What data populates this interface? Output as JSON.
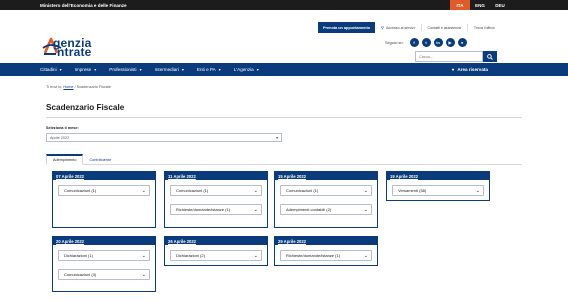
{
  "topbar": {
    "ministry": "Ministero dell'Economia e delle Finanze",
    "languages": [
      "ITA",
      "ENG",
      "DEU"
    ]
  },
  "utilbar": {
    "appointment": "Prenota un appuntamento",
    "links": [
      "Accesso ai servizi",
      "Contatti e assistenza",
      "Trova l'ufficio"
    ]
  },
  "logo": {
    "line1": "genzia",
    "line2": "ntrate"
  },
  "social": {
    "label": "Seguici su:",
    "icons": [
      "f",
      "t",
      "in",
      "▶",
      "●"
    ]
  },
  "search": {
    "placeholder": "Cerca..."
  },
  "nav": {
    "items": [
      "Cittadini",
      "Imprese",
      "Professionisti",
      "Intermediari",
      "Enti e PA",
      "L'Agenzia"
    ],
    "area": "Area riservata"
  },
  "breadcrumb": {
    "prefix": "Ti trovi in:",
    "home": "Home",
    "sep": "/",
    "current": "Scadenzario Fiscale"
  },
  "page": {
    "title": "Scadenzario Fiscale"
  },
  "filter": {
    "label": "Seleziona il mese:",
    "value": "Aprile 2022"
  },
  "tabs": [
    "Adempimento",
    "Contribuente"
  ],
  "cards": [
    {
      "date": "07 Aprile 2022",
      "rows": [
        "Comunicazioni (1)"
      ]
    },
    {
      "date": "11 Aprile 2022",
      "rows": [
        "Comunicazioni (1)",
        "Richieste/domande/istanze (1)"
      ]
    },
    {
      "date": "15 Aprile 2022",
      "rows": [
        "Comunicazioni (1)",
        "Adempimenti contabili (2)"
      ]
    },
    {
      "date": "19 Aprile 2022",
      "rows": [
        "Versamenti (58)"
      ]
    },
    {
      "date": "20 Aprile 2022",
      "rows": [
        "Dichiarazioni (1)",
        "Comunicazioni (3)"
      ]
    },
    {
      "date": "26 Aprile 2022",
      "rows": [
        "Dichiarazioni (2)"
      ]
    },
    {
      "date": "29 Aprile 2022",
      "rows": [
        "Richieste/domande/istanze (1)"
      ]
    }
  ]
}
